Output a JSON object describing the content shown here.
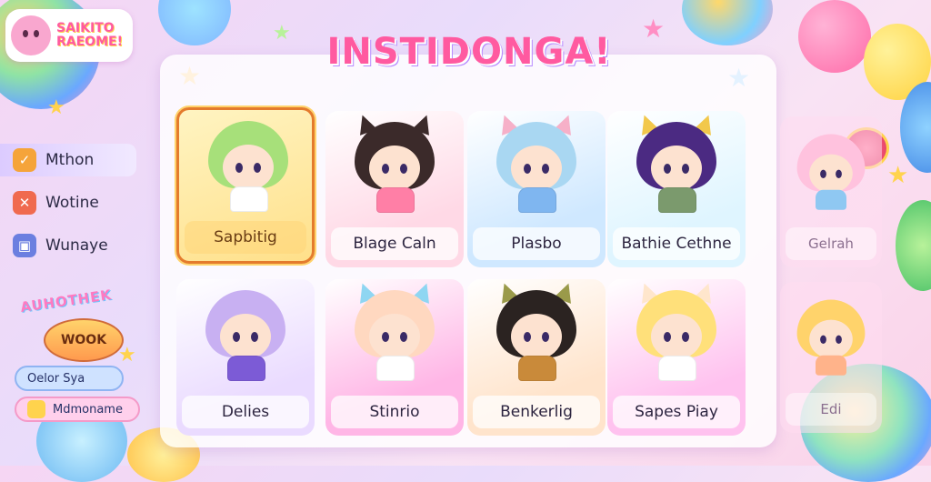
{
  "logo": {
    "text": "SAIKITO\nRAEOME!",
    "icon": "kitty-face-icon"
  },
  "sidebar": {
    "items": [
      {
        "label": "Mthon",
        "icon": "check-icon",
        "color": "#f5a43a"
      },
      {
        "label": "Wotine",
        "icon": "close-icon",
        "color": "#f06a4f"
      },
      {
        "label": "Wunaye",
        "icon": "image-icon",
        "color": "#6b7fe0"
      }
    ],
    "badge_title": "AUHOTHEK",
    "badge_label": "WOOK",
    "pill1": "Oelor Sya",
    "pill2": "Mdmoname"
  },
  "main": {
    "title": "INSTIDONGA!"
  },
  "cards": [
    {
      "name": "Sapbitig",
      "hair": "#a7e07a",
      "bg": "#ffe08a",
      "body": "#ffffff",
      "ears": ""
    },
    {
      "name": "Blage Caln",
      "hair": "#3b2a2a",
      "bg": "#ffd9e6",
      "body": "#ff7fa6",
      "ears": "#3b2a2a"
    },
    {
      "name": "Plasbo",
      "hair": "#a9d7f2",
      "bg": "#cfe8ff",
      "body": "#7fb6f0",
      "ears": "#f6b0c8"
    },
    {
      "name": "Bathie Cethne",
      "hair": "#4b2a82",
      "bg": "#dff5ff",
      "body": "#7b9a6d",
      "ears": "#f2c84b"
    },
    {
      "name": "Delies",
      "hair": "#c8b0f2",
      "bg": "#eadbff",
      "body": "#7c5bd6",
      "ears": ""
    },
    {
      "name": "Stinrio",
      "hair": "#ffd8c0",
      "bg": "#ffb6e6",
      "body": "#ffffff",
      "ears": "#8fd6f2"
    },
    {
      "name": "Benkerlig",
      "hair": "#2b2321",
      "bg": "#ffe4cc",
      "body": "#c98a3a",
      "ears": "#9a9a4a"
    },
    {
      "name": "Sapes Piay",
      "hair": "#ffe07a",
      "bg": "#ffc2ef",
      "body": "#ffffff",
      "ears": "#ffe6cc"
    }
  ],
  "ghosts": [
    {
      "name": "Gelrah"
    },
    {
      "name": "Edi"
    }
  ]
}
